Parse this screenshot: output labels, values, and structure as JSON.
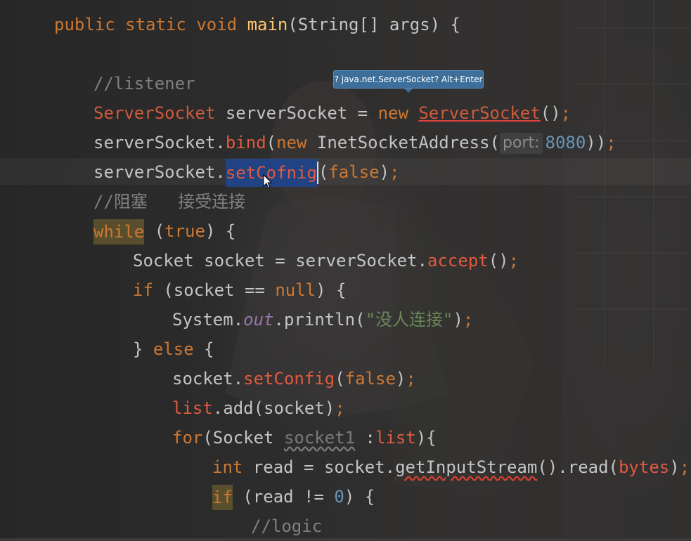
{
  "editor": {
    "tooltip": "? java.net.ServerSocket? Alt+Enter",
    "lines": [
      {
        "segments": [
          {
            "t": "public ",
            "c": "kw"
          },
          {
            "t": "static ",
            "c": "kw"
          },
          {
            "t": "void ",
            "c": "kw"
          },
          {
            "t": "main",
            "c": "fn"
          },
          {
            "t": "(String[] args) {",
            "c": "plain"
          }
        ]
      },
      {
        "segments": [
          {
            "t": "//listener",
            "c": "cm"
          }
        ]
      },
      {
        "segments": [
          {
            "t": "ServerSocket",
            "c": "cls"
          },
          {
            "t": " serverSocket = ",
            "c": "plain"
          },
          {
            "t": "new ",
            "c": "kw"
          },
          {
            "t": "ServerSocket",
            "c": "cls-err"
          },
          {
            "t": "()",
            "c": "plain"
          },
          {
            "t": ";",
            "c": "kw"
          }
        ]
      },
      {
        "segments": [
          {
            "t": "serverSocket.",
            "c": "plain"
          },
          {
            "t": "bind",
            "c": "mth"
          },
          {
            "t": "(",
            "c": "plain"
          },
          {
            "t": "new ",
            "c": "kw"
          },
          {
            "t": "InetSocketAddress(",
            "c": "plain"
          },
          {
            "t": "port:",
            "c": "hint"
          },
          {
            "t": "8080",
            "c": "num"
          },
          {
            "t": "))",
            "c": "plain"
          },
          {
            "t": ";",
            "c": "kw"
          }
        ]
      },
      {
        "segments": [
          {
            "t": "serverSocket.",
            "c": "plain"
          },
          {
            "t": "setCofnig",
            "c": "mth-sel"
          },
          {
            "t": "",
            "c": "caret"
          },
          {
            "t": "(",
            "c": "plain"
          },
          {
            "t": "false",
            "c": "kw"
          },
          {
            "t": ")",
            "c": "plain"
          },
          {
            "t": ";",
            "c": "kw"
          }
        ]
      },
      {
        "segments": [
          {
            "t": "//阻塞   接受连接",
            "c": "cm"
          }
        ]
      },
      {
        "segments": [
          {
            "t": "while",
            "c": "hl-kw"
          },
          {
            "t": " (",
            "c": "plain"
          },
          {
            "t": "true",
            "c": "kw"
          },
          {
            "t": ") {",
            "c": "plain"
          }
        ]
      },
      {
        "segments": [
          {
            "t": "Socket socket = serverSocket.",
            "c": "plain"
          },
          {
            "t": "accept",
            "c": "mth"
          },
          {
            "t": "()",
            "c": "plain"
          },
          {
            "t": ";",
            "c": "kw"
          }
        ]
      },
      {
        "segments": [
          {
            "t": "if ",
            "c": "kw"
          },
          {
            "t": "(socket == ",
            "c": "plain"
          },
          {
            "t": "null",
            "c": "kw"
          },
          {
            "t": ") {",
            "c": "plain"
          }
        ]
      },
      {
        "segments": [
          {
            "t": "System.",
            "c": "plain"
          },
          {
            "t": "out",
            "c": "field"
          },
          {
            "t": ".println(",
            "c": "plain"
          },
          {
            "t": "\"没人连接\"",
            "c": "str"
          },
          {
            "t": ")",
            "c": "plain"
          },
          {
            "t": ";",
            "c": "kw"
          }
        ]
      },
      {
        "segments": [
          {
            "t": "} ",
            "c": "plain"
          },
          {
            "t": "else ",
            "c": "kw"
          },
          {
            "t": "{",
            "c": "plain"
          }
        ]
      },
      {
        "segments": [
          {
            "t": "socket.",
            "c": "plain"
          },
          {
            "t": "setConfig",
            "c": "mth"
          },
          {
            "t": "(",
            "c": "plain"
          },
          {
            "t": "false",
            "c": "kw"
          },
          {
            "t": ")",
            "c": "plain"
          },
          {
            "t": ";",
            "c": "kw"
          }
        ]
      },
      {
        "segments": [
          {
            "t": "list",
            "c": "mth"
          },
          {
            "t": ".add(socket)",
            "c": "plain"
          },
          {
            "t": ";",
            "c": "kw"
          }
        ]
      },
      {
        "segments": [
          {
            "t": "for",
            "c": "kw"
          },
          {
            "t": "(Socket ",
            "c": "plain"
          },
          {
            "t": "socket1",
            "c": "unused"
          },
          {
            "t": " :",
            "c": "plain"
          },
          {
            "t": "list",
            "c": "mth"
          },
          {
            "t": "){",
            "c": "plain"
          }
        ]
      },
      {
        "segments": [
          {
            "t": "int ",
            "c": "kw"
          },
          {
            "t": "read = socket.",
            "c": "plain"
          },
          {
            "t": "getInputStream",
            "c": "wavy"
          },
          {
            "t": "().read(",
            "c": "plain"
          },
          {
            "t": "bytes",
            "c": "mth"
          },
          {
            "t": ")",
            "c": "plain"
          },
          {
            "t": ";",
            "c": "kw"
          }
        ]
      },
      {
        "segments": [
          {
            "t": "if",
            "c": "hl-kw"
          },
          {
            "t": " (read != ",
            "c": "plain"
          },
          {
            "t": "0",
            "c": "num"
          },
          {
            "t": ") {",
            "c": "plain"
          }
        ]
      },
      {
        "segments": [
          {
            "t": "//logic",
            "c": "cm"
          }
        ]
      }
    ]
  }
}
